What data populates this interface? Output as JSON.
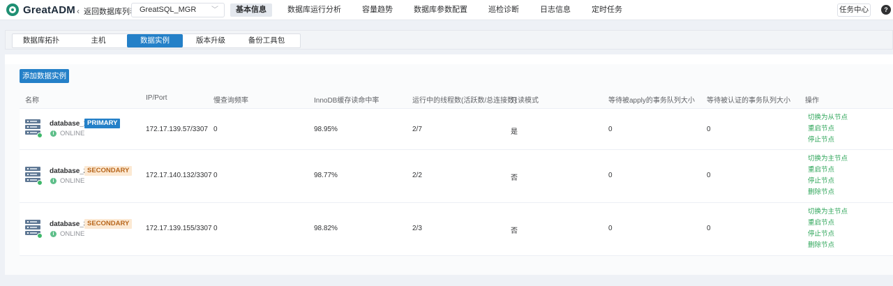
{
  "app": {
    "name": "GreatADM"
  },
  "header": {
    "back_label": "返回数据库列表",
    "db_select": "GreatSQL_MGR",
    "nav": [
      "基本信息",
      "数据库运行分析",
      "容量趋势",
      "数据库参数配置",
      "巡检诊断",
      "日志信息",
      "定时任务"
    ],
    "active_nav": "基本信息",
    "task_center": "任务中心",
    "help": "?"
  },
  "tabs": [
    "数据库拓扑",
    "主机",
    "数据实例",
    "版本升级",
    "备份工具包"
  ],
  "active_tab": "数据实例",
  "add_button": "添加数据实例",
  "table": {
    "columns": [
      "名称",
      "IP/Port",
      "慢查询频率",
      "InnoDB缓存读命中率",
      "运行中的线程数(活跃数/总连接数)",
      "只读模式",
      "等待被apply的事务队列大小",
      "等待被认证的事务队列大小",
      "操作"
    ],
    "rows": [
      {
        "name": "database_1",
        "role": "PRIMARY",
        "status": "ONLINE",
        "ip_port": "172.17.139.57/3307",
        "slow_query": "0",
        "hit_rate": "98.95%",
        "threads": "2/7",
        "read_only": "是",
        "apply_queue": "0",
        "certify_queue": "0",
        "ops": [
          "切换为从节点",
          "重启节点",
          "停止节点"
        ]
      },
      {
        "name": "database_2",
        "role": "SECONDARY",
        "status": "ONLINE",
        "ip_port": "172.17.140.132/3307",
        "slow_query": "0",
        "hit_rate": "98.77%",
        "threads": "2/2",
        "read_only": "否",
        "apply_queue": "0",
        "certify_queue": "0",
        "ops": [
          "切换为主节点",
          "重启节点",
          "停止节点",
          "删除节点"
        ]
      },
      {
        "name": "database_3",
        "role": "SECONDARY",
        "status": "ONLINE",
        "ip_port": "172.17.139.155/3307",
        "slow_query": "0",
        "hit_rate": "98.82%",
        "threads": "2/3",
        "read_only": "否",
        "apply_queue": "0",
        "certify_queue": "0",
        "ops": [
          "切换为主节点",
          "重启节点",
          "停止节点",
          "删除节点"
        ]
      }
    ]
  },
  "colors": {
    "primary": "#2480c8",
    "link": "#2fa65a",
    "online": "#3fb86a",
    "secondary_badge_bg": "#fce9d3",
    "secondary_badge_fg": "#b8661b"
  }
}
